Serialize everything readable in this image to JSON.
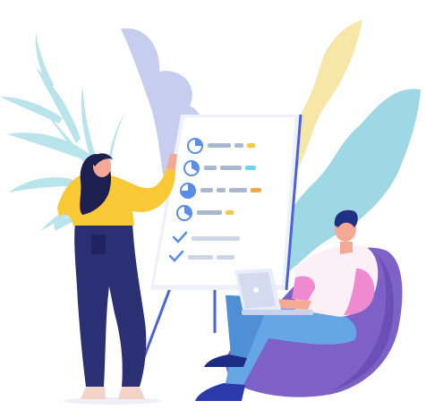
{
  "scene": {
    "kind": "flat-illustration",
    "colors": {
      "background": "#ffffff",
      "leaf_light_blue": "#b9e4ec",
      "leaf_teal": "#9ed8e4",
      "leaf_lavender": "#c6cdef",
      "leaf_pale_yellow": "#f6e6a8",
      "board": "#ffffff",
      "board_frame": "#4b63d6",
      "accent_blue": "#5b8de6",
      "accent_yellow": "#f6c84a",
      "accent_cyan": "#74d3e8",
      "accent_orange": "#f4a84a",
      "woman_top": "#f8c935",
      "woman_pants": "#2b2f74",
      "woman_hair": "#1d1f4f",
      "man_shirt": "#fbf0f6",
      "man_shirt_accent": "#f08ad0",
      "man_jeans": "#64a6e6",
      "man_hair": "#223084",
      "beanbag": "#7e61c6",
      "laptop": "#e9edf7",
      "skin": "#f3a996"
    },
    "board_rows": [
      {
        "icon": "pie-chart-icon",
        "accents": [
          "accent_yellow"
        ]
      },
      {
        "icon": "pie-chart-icon",
        "accents": [
          "accent_cyan"
        ]
      },
      {
        "icon": "pie-chart-icon",
        "accents": [
          "accent_orange"
        ]
      },
      {
        "icon": "pie-chart-icon",
        "accents": [
          "accent_yellow"
        ]
      },
      {
        "icon": "checkmark-icon",
        "accents": []
      },
      {
        "icon": "checkmark-icon",
        "accents": []
      }
    ]
  }
}
